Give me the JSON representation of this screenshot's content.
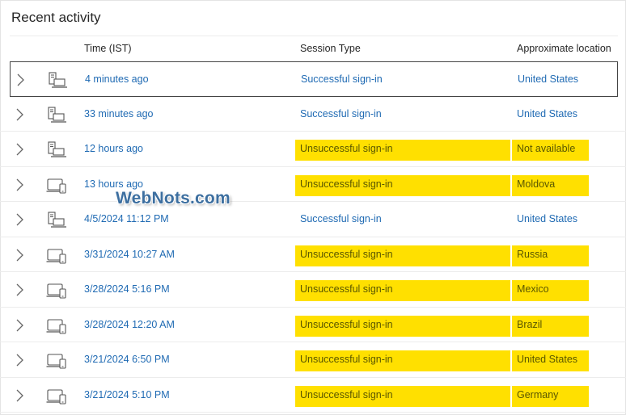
{
  "title": "Recent activity",
  "columns": {
    "time": "Time (IST)",
    "type": "Session Type",
    "location": "Approximate location"
  },
  "rows": [
    {
      "time": "4 minutes ago",
      "type": "Successful sign-in",
      "location": "United States",
      "device": "desktop-icon",
      "failed": false
    },
    {
      "time": "33 minutes ago",
      "type": "Successful sign-in",
      "location": "United States",
      "device": "desktop-icon",
      "failed": false
    },
    {
      "time": "12 hours ago",
      "type": "Unsuccessful sign-in",
      "location": "Not available",
      "device": "desktop-icon",
      "failed": true
    },
    {
      "time": "13 hours ago",
      "type": "Unsuccessful sign-in",
      "location": "Moldova",
      "device": "devices-icon",
      "failed": true
    },
    {
      "time": "4/5/2024 11:12 PM",
      "type": "Successful sign-in",
      "location": "United States",
      "device": "desktop-icon",
      "failed": false
    },
    {
      "time": "3/31/2024 10:27 AM",
      "type": "Unsuccessful sign-in",
      "location": "Russia",
      "device": "devices-icon",
      "failed": true
    },
    {
      "time": "3/28/2024 5:16 PM",
      "type": "Unsuccessful sign-in",
      "location": "Mexico",
      "device": "devices-icon",
      "failed": true
    },
    {
      "time": "3/28/2024 12:20 AM",
      "type": "Unsuccessful sign-in",
      "location": "Brazil",
      "device": "devices-icon",
      "failed": true
    },
    {
      "time": "3/21/2024 6:50 PM",
      "type": "Unsuccessful sign-in",
      "location": "United States",
      "device": "devices-icon",
      "failed": true
    },
    {
      "time": "3/21/2024 5:10 PM",
      "type": "Unsuccessful sign-in",
      "location": "Germany",
      "device": "devices-icon",
      "failed": true
    }
  ],
  "watermark": "WebNots.com",
  "colors": {
    "link": "#1f6ab3",
    "highlight": "#ffe000"
  }
}
